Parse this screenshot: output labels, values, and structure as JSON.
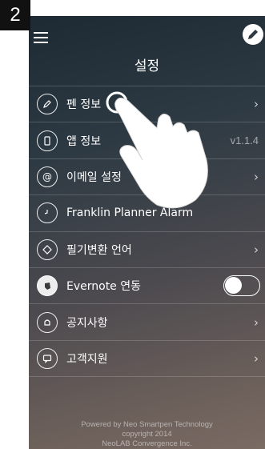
{
  "step_number": "2",
  "header": {
    "title": "설정"
  },
  "settings": [
    {
      "label": "펜 정보",
      "icon": "pen-icon",
      "accessory": "chevron"
    },
    {
      "label": "앱 정보",
      "icon": "phone-icon",
      "accessory": "version",
      "value": "v1.1.4"
    },
    {
      "label": "이메일 설정",
      "icon": "at-icon",
      "accessory": "chevron"
    },
    {
      "label": "Franklin Planner Alarm",
      "icon": "clock-icon",
      "accessory": "none"
    },
    {
      "label": "필기변환 언어",
      "icon": "language-icon",
      "accessory": "chevron"
    },
    {
      "label": "Evernote 연동",
      "icon": "evernote-icon",
      "accessory": "toggle",
      "toggle_on": false
    },
    {
      "label": "공지사항",
      "icon": "bell-icon",
      "accessory": "chevron"
    },
    {
      "label": "고객지원",
      "icon": "chat-icon",
      "accessory": "chevron"
    }
  ],
  "chevron": "›",
  "footer": {
    "line1": "Powered by Neo Smartpen Technology",
    "line2": "copyright 2014",
    "line3": "NeoLAB Convergence Inc."
  }
}
